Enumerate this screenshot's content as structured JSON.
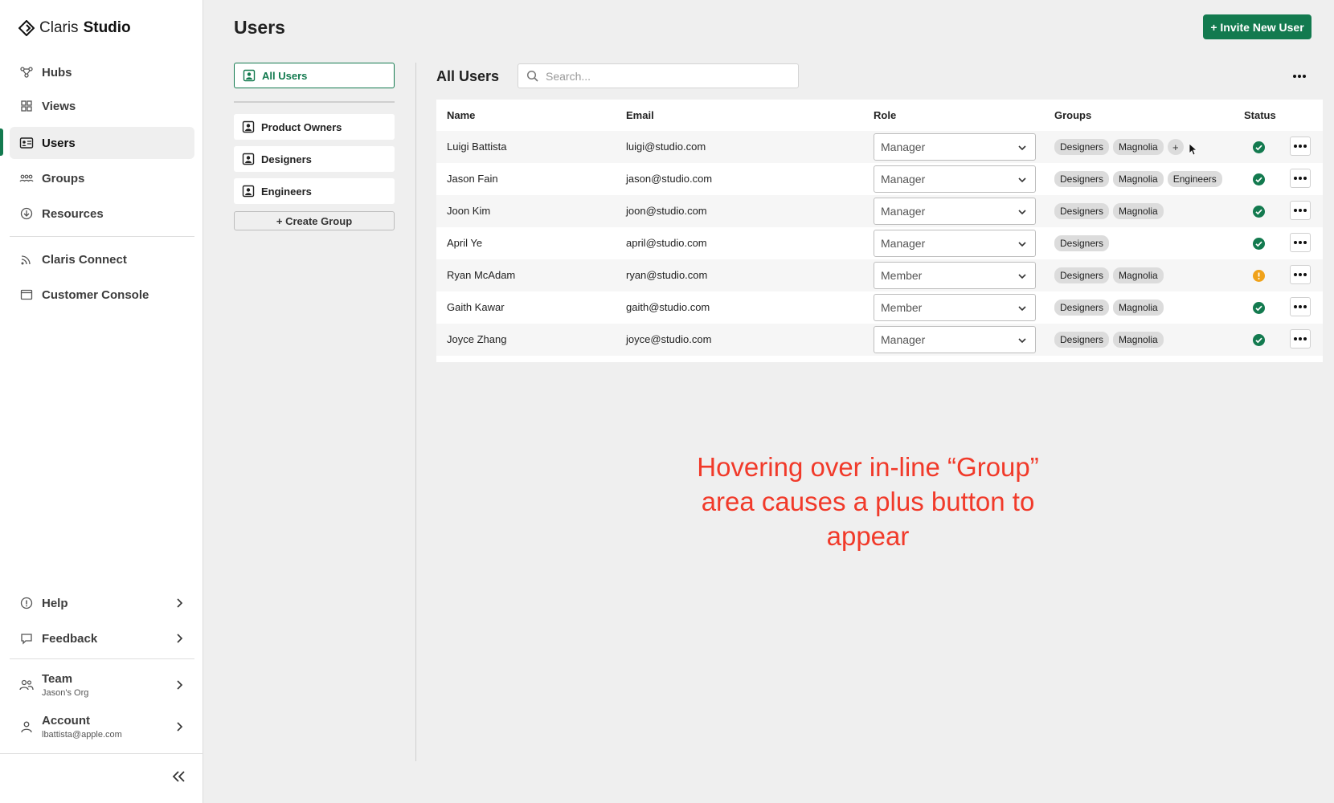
{
  "brand": {
    "name_light": "Claris",
    "name_bold": "Studio"
  },
  "sidebar": {
    "items": [
      {
        "label": "Hubs",
        "icon": "hubs-icon"
      },
      {
        "label": "Views",
        "icon": "views-icon"
      },
      {
        "label": "Users",
        "icon": "users-icon",
        "active": true
      },
      {
        "label": "Groups",
        "icon": "groups-icon"
      },
      {
        "label": "Resources",
        "icon": "resources-icon"
      }
    ],
    "secondary": [
      {
        "label": "Claris Connect",
        "icon": "connect-icon"
      },
      {
        "label": "Customer Console",
        "icon": "console-icon"
      }
    ],
    "bottom": [
      {
        "label": "Help",
        "icon": "help-icon"
      },
      {
        "label": "Feedback",
        "icon": "feedback-icon"
      }
    ],
    "team": {
      "label": "Team",
      "sub": "Jason's Org"
    },
    "account": {
      "label": "Account",
      "sub": "lbattista@apple.com"
    }
  },
  "header": {
    "title": "Users",
    "invite_label": "+ Invite New User"
  },
  "groups_panel": {
    "all_users": "All Users",
    "groups": [
      "Product Owners",
      "Designers",
      "Engineers"
    ],
    "create_label": "+ Create Group"
  },
  "main": {
    "title": "All Users",
    "search_placeholder": "Search...",
    "columns": {
      "name": "Name",
      "email": "Email",
      "role": "Role",
      "groups": "Groups",
      "status": "Status"
    },
    "rows": [
      {
        "name": "Luigi Battista",
        "email": "luigi@studio.com",
        "role": "Manager",
        "groups": [
          "Designers",
          "Magnolia"
        ],
        "show_plus": true,
        "status": "active"
      },
      {
        "name": "Jason Fain",
        "email": "jason@studio.com",
        "role": "Manager",
        "groups": [
          "Designers",
          "Magnolia",
          "Engineers"
        ],
        "status": "active"
      },
      {
        "name": "Joon Kim",
        "email": "joon@studio.com",
        "role": "Manager",
        "groups": [
          "Designers",
          "Magnolia"
        ],
        "status": "active"
      },
      {
        "name": "April Ye",
        "email": "april@studio.com",
        "role": "Manager",
        "groups": [
          "Designers"
        ],
        "status": "active"
      },
      {
        "name": "Ryan McAdam",
        "email": "ryan@studio.com",
        "role": "Member",
        "groups": [
          "Designers",
          "Magnolia"
        ],
        "status": "warning"
      },
      {
        "name": "Gaith Kawar",
        "email": "gaith@studio.com",
        "role": "Member",
        "groups": [
          "Designers",
          "Magnolia"
        ],
        "status": "active"
      },
      {
        "name": "Joyce Zhang",
        "email": "joyce@studio.com",
        "role": "Manager",
        "groups": [
          "Designers",
          "Magnolia"
        ],
        "status": "active"
      }
    ],
    "plus_label": "+"
  },
  "annotation": {
    "text": "Hovering over in-line “Group” area causes a plus button to appear"
  },
  "colors": {
    "accent": "#137a4f",
    "status_ok": "#137a4f",
    "status_warn": "#f0a21a",
    "annotation": "#f13a2a"
  }
}
